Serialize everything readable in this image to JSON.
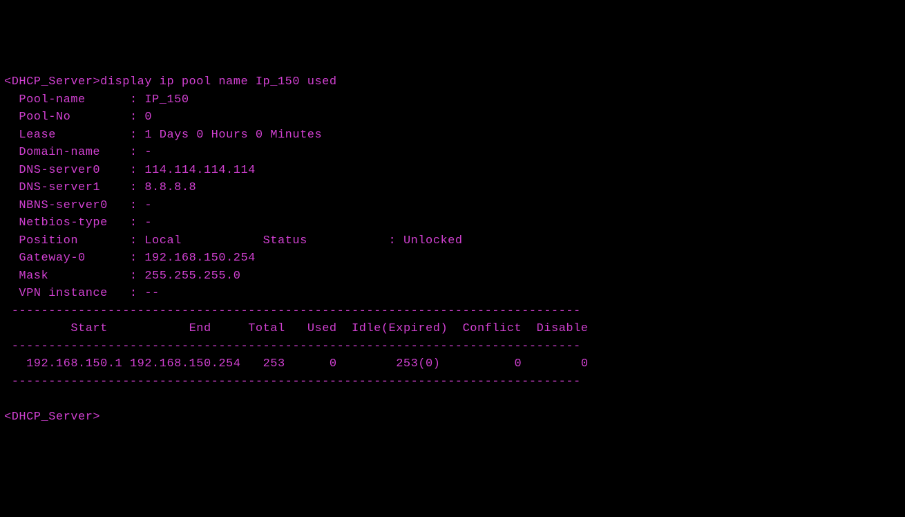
{
  "prompt1": "<DHCP_Server>",
  "command": "display ip pool name Ip_150 used",
  "labels": {
    "pool_name": "Pool-name",
    "pool_no": "Pool-No",
    "lease": "Lease",
    "domain_name": "Domain-name",
    "dns0": "DNS-server0",
    "dns1": "DNS-server1",
    "nbns0": "NBNS-server0",
    "netbios": "Netbios-type",
    "position": "Position",
    "status": "Status",
    "gateway0": "Gateway-0",
    "mask": "Mask",
    "vpn": "VPN instance"
  },
  "values": {
    "pool_name": "IP_150",
    "pool_no": "0",
    "lease": "1 Days 0 Hours 0 Minutes",
    "domain_name": "-",
    "dns0": "114.114.114.114",
    "dns1": "8.8.8.8",
    "nbns0": "-",
    "netbios": "-",
    "position": "Local",
    "status": "Unlocked",
    "gateway0": "192.168.150.254",
    "mask": "255.255.255.0",
    "vpn": "--"
  },
  "table": {
    "divider": " -----------------------------------------------------------------------------",
    "headers": {
      "start": "Start",
      "end": "End",
      "total": "Total",
      "used": "Used",
      "idle": "Idle(Expired)",
      "conflict": "Conflict",
      "disable": "Disable"
    },
    "row": {
      "start": "192.168.150.1",
      "end": "192.168.150.254",
      "total": "253",
      "used": "0",
      "idle": "253(0)",
      "conflict": "0",
      "disable": "0"
    }
  },
  "prompt2": "<DHCP_Server>"
}
